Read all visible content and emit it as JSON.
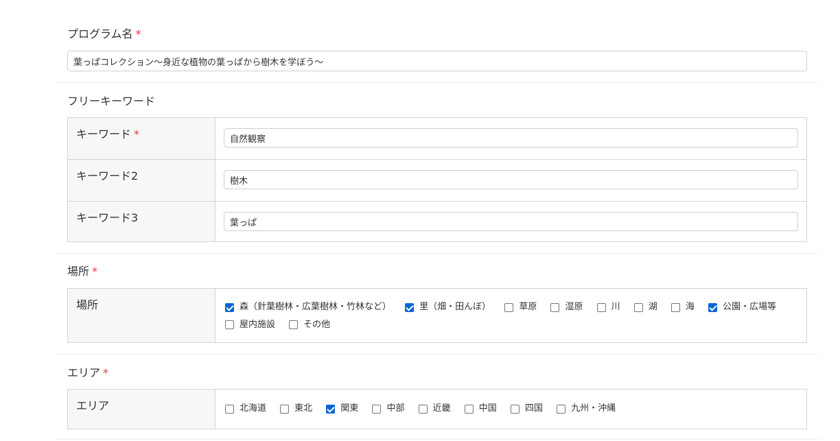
{
  "program_name": {
    "label": "プログラム名",
    "required_mark": "*",
    "value": "葉っぱコレクション～身近な植物の葉っぱから樹木を学ぼう～"
  },
  "keywords": {
    "section_label": "フリーキーワード",
    "rows": [
      {
        "label": "キーワード",
        "required_mark": "*",
        "value": "自然観察"
      },
      {
        "label": "キーワード2",
        "value": "樹木"
      },
      {
        "label": "キーワード3",
        "value": "葉っぱ"
      }
    ]
  },
  "place": {
    "section_label": "場所",
    "required_mark": "*",
    "row_label": "場所",
    "options": [
      {
        "label": "森（針葉樹林・広葉樹林・竹林など）",
        "checked": true
      },
      {
        "label": "里（畑・田んぼ）",
        "checked": true
      },
      {
        "label": "草原",
        "checked": false
      },
      {
        "label": "湿原",
        "checked": false
      },
      {
        "label": "川",
        "checked": false
      },
      {
        "label": "湖",
        "checked": false
      },
      {
        "label": "海",
        "checked": false
      },
      {
        "label": "公園・広場等",
        "checked": true
      },
      {
        "label": "屋内施設",
        "checked": false
      },
      {
        "label": "その他",
        "checked": false
      }
    ]
  },
  "area": {
    "section_label": "エリア",
    "required_mark": "*",
    "row_label": "エリア",
    "options": [
      {
        "label": "北海道",
        "checked": false
      },
      {
        "label": "東北",
        "checked": false
      },
      {
        "label": "関東",
        "checked": true
      },
      {
        "label": "中部",
        "checked": false
      },
      {
        "label": "近畿",
        "checked": false
      },
      {
        "label": "中国",
        "checked": false
      },
      {
        "label": "四国",
        "checked": false
      },
      {
        "label": "九州・沖縄",
        "checked": false
      }
    ]
  },
  "colors": {
    "required": "#e03a3a",
    "checkbox_checked": "#0a66d6",
    "table_border": "#d4d4d4",
    "row_head_bg": "#f7f7f7"
  }
}
